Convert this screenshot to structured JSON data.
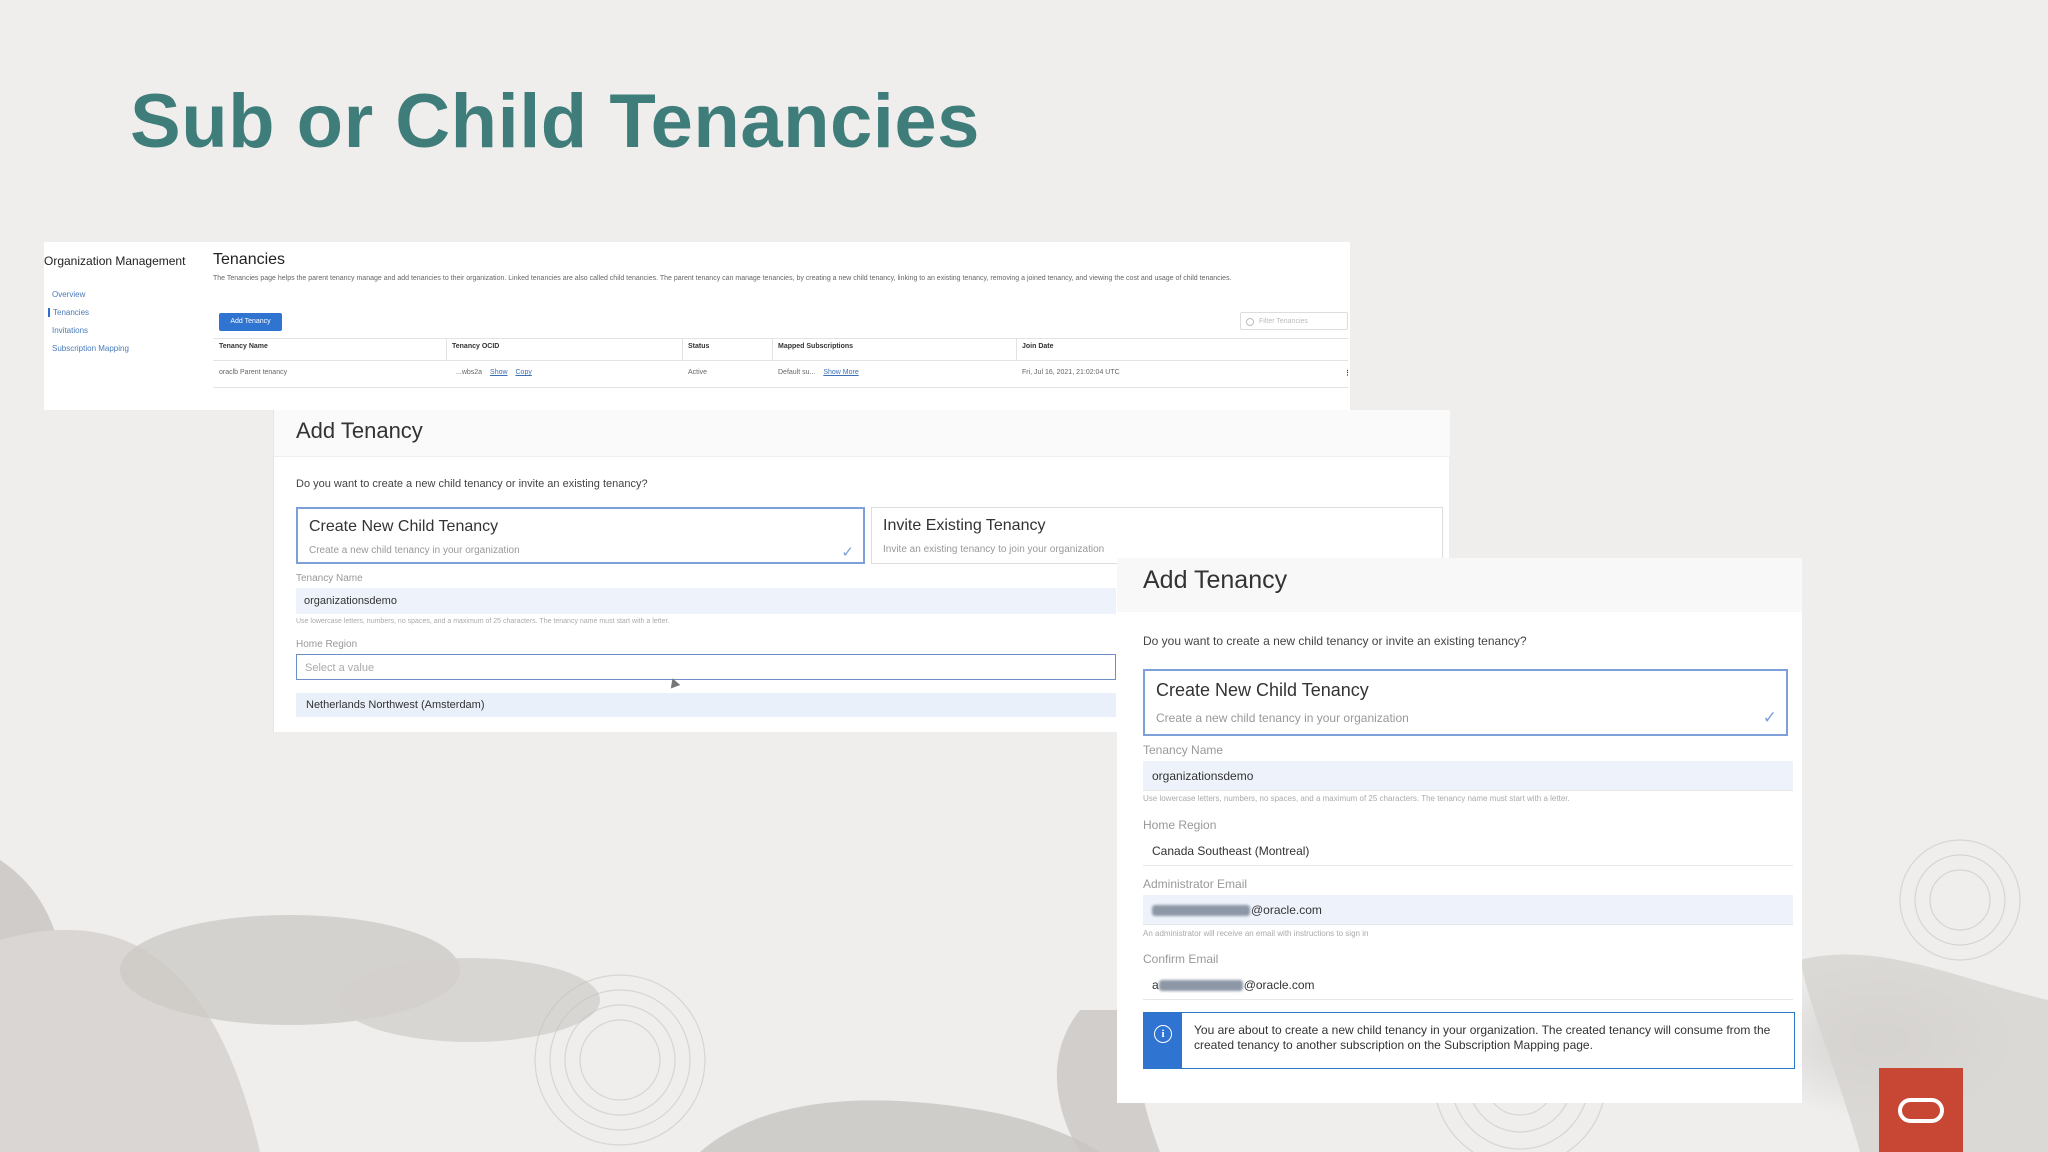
{
  "slide": {
    "title": "Sub or Child Tenancies"
  },
  "colors": {
    "title": "#3f7d7b",
    "accent_blue": "#2f74d0",
    "oracle_red": "#c74634"
  },
  "icons": [
    "search-icon",
    "check-icon",
    "info-icon",
    "oracle-logo-icon"
  ],
  "shot1": {
    "org_title": "Organization Management",
    "nav": [
      "Overview",
      "Tenancies",
      "Invitations",
      "Subscription Mapping"
    ],
    "page_heading": "Tenancies",
    "description": "The Tenancies page helps the parent tenancy manage and add tenancies to their organization. Linked tenancies are also called child tenancies. The parent tenancy can manage tenancies, by creating a new child tenancy, linking to an existing tenancy, removing a joined tenancy, and viewing the cost and usage of child tenancies.",
    "add_button": "Add Tenancy",
    "filter_placeholder": "Filter Tenancies",
    "columns": [
      "Tenancy Name",
      "Tenancy OCID",
      "Status",
      "Mapped Subscriptions",
      "Join Date"
    ],
    "row": {
      "name": "oraclb Parent tenancy",
      "ocid": "...wbs2a",
      "ocid_show": "Show",
      "ocid_copy": "Copy",
      "status": "Active",
      "subscriptions": "Default su...",
      "show_more": "Show More",
      "join_date": "Fri, Jul 16, 2021, 21:02:04 UTC",
      "kebab": "⋮"
    }
  },
  "shot2": {
    "title": "Add Tenancy",
    "question": "Do you want to create a new child tenancy or invite an existing tenancy?",
    "option_create_title": "Create New Child Tenancy",
    "option_create_sub": "Create a new child tenancy in your organization",
    "option_invite_title": "Invite Existing Tenancy",
    "option_invite_sub": "Invite an existing tenancy to join your organization",
    "check": "✓",
    "tenancy_name_label": "Tenancy Name",
    "tenancy_name_value": "organizationsdemo",
    "tenancy_name_hint": "Use lowercase letters, numbers, no spaces, and a maximum of 25 characters. The tenancy name must start with a letter.",
    "home_region_label": "Home Region",
    "home_region_placeholder": "Select a value",
    "dropdown_option": "Netherlands Northwest (Amsterdam)"
  },
  "shot3": {
    "title": "Add Tenancy",
    "question": "Do you want to create a new child tenancy or invite an existing tenancy?",
    "option_create_title": "Create New Child Tenancy",
    "option_create_sub": "Create a new child tenancy in your organization",
    "check": "✓",
    "tenancy_name_label": "Tenancy Name",
    "tenancy_name_value": "organizationsdemo",
    "tenancy_name_hint": "Use lowercase letters, numbers, no spaces, and a maximum of 25 characters. The tenancy name must start with a letter.",
    "home_region_label": "Home Region",
    "home_region_value": "Canada Southeast (Montreal)",
    "admin_email_label": "Administrator Email",
    "admin_email_domain": "@oracle.com",
    "admin_email_hint": "An administrator will receive an email with instructions to sign in",
    "confirm_email_label": "Confirm Email",
    "confirm_email_prefix": "a",
    "confirm_email_domain": "@oracle.com",
    "info_icon": "i",
    "info_text": "You are about to create a new child tenancy in your organization. The created tenancy will consume from the created tenancy to another subscription on the Subscription Mapping page."
  }
}
